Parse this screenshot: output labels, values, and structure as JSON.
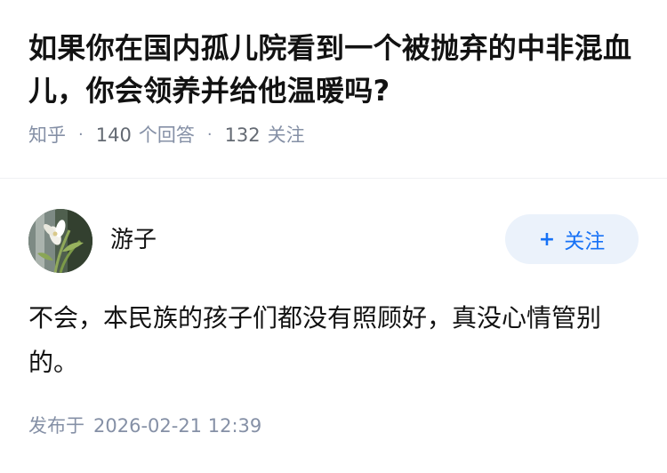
{
  "question": {
    "title": "如果你在国内孤儿院看到一个被抛弃的中非混血儿，你会领养并给他温暖吗?",
    "source": "知乎",
    "separator": "·",
    "answer_count_num": "140",
    "answer_count_label": "个回答",
    "follower_count_num": "132",
    "follower_count_label": "关注"
  },
  "answer": {
    "author": {
      "name": "游子",
      "avatar_icon": "avatar-photo-flower"
    },
    "follow_button": {
      "plus_icon": "+",
      "label": "关注"
    },
    "content": "不会，本民族的孩子们都没有照顾好，真没心情管别的。",
    "footer": {
      "published_label": "发布于",
      "published_time": "2026-02-21 12:39"
    }
  },
  "colors": {
    "accent": "#1772f6",
    "button_bg": "#ebf2fb",
    "meta_text": "#8590a6",
    "title_text": "#121212"
  }
}
